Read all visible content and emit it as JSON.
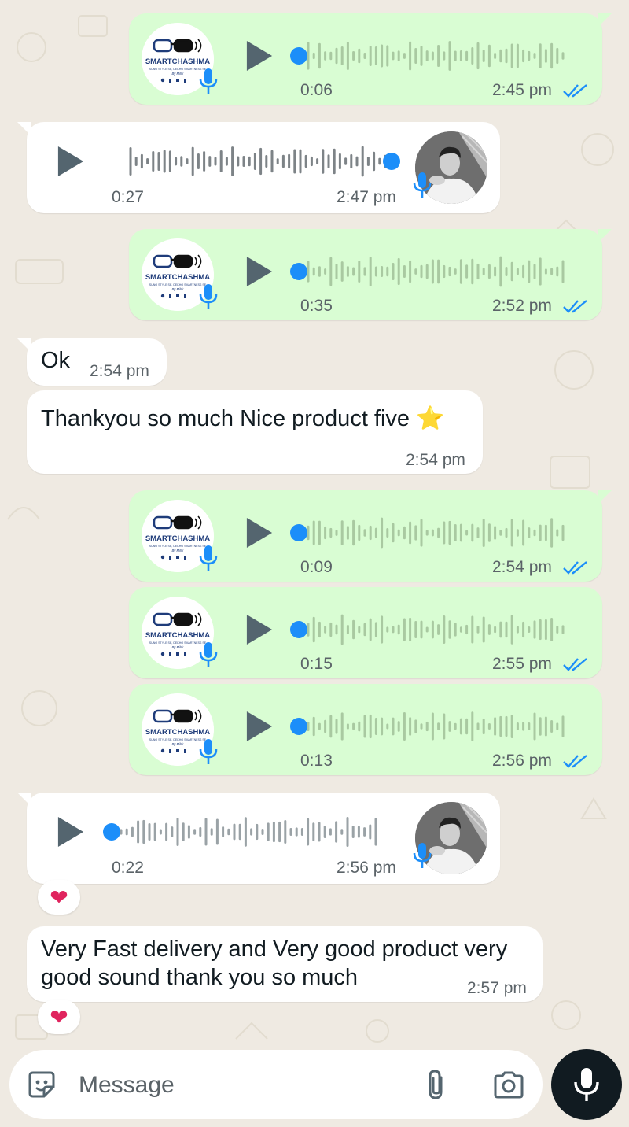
{
  "colors": {
    "outgoing_bubble": "#d9fdd3",
    "incoming_bubble": "#ffffff",
    "accent_blue": "#1c8ef9",
    "read_ticks": "#53bdeb",
    "wallpaper": "#efeae2"
  },
  "brand_avatar": {
    "name": "SMARTCHASHMA",
    "tagline": "SUNO STYLE SE, DEKHO SMARTNESS SE",
    "signature": "By Mihir"
  },
  "messages": [
    {
      "direction": "outgoing",
      "type": "voice",
      "duration": "0:06",
      "time": "2:45 pm",
      "progress": 0
    },
    {
      "direction": "incoming",
      "type": "voice",
      "duration": "0:27",
      "time": "2:47 pm",
      "progress": 1
    },
    {
      "direction": "outgoing",
      "type": "voice",
      "duration": "0:35",
      "time": "2:52 pm",
      "progress": 0
    },
    {
      "direction": "incoming",
      "type": "text",
      "text": "Ok",
      "time": "2:54 pm"
    },
    {
      "direction": "incoming",
      "type": "text",
      "text": "Thankyou so much Nice product five ⭐",
      "time": "2:54 pm"
    },
    {
      "direction": "outgoing",
      "type": "voice",
      "duration": "0:09",
      "time": "2:54 pm",
      "progress": 0
    },
    {
      "direction": "outgoing",
      "type": "voice",
      "duration": "0:15",
      "time": "2:55 pm",
      "progress": 0
    },
    {
      "direction": "outgoing",
      "type": "voice",
      "duration": "0:13",
      "time": "2:56 pm",
      "progress": 0
    },
    {
      "direction": "incoming",
      "type": "voice",
      "duration": "0:22",
      "time": "2:56 pm",
      "progress": 0,
      "reaction": "❤"
    },
    {
      "direction": "incoming",
      "type": "text",
      "text_line1": "Very Fast delivery and Very good product very",
      "text_line2": "good sound thank you so much",
      "time": "2:57 pm",
      "reaction": "❤"
    }
  ],
  "composer": {
    "placeholder": "Message",
    "icons": [
      "sticker-icon",
      "attach-icon",
      "camera-icon",
      "mic-icon"
    ]
  }
}
